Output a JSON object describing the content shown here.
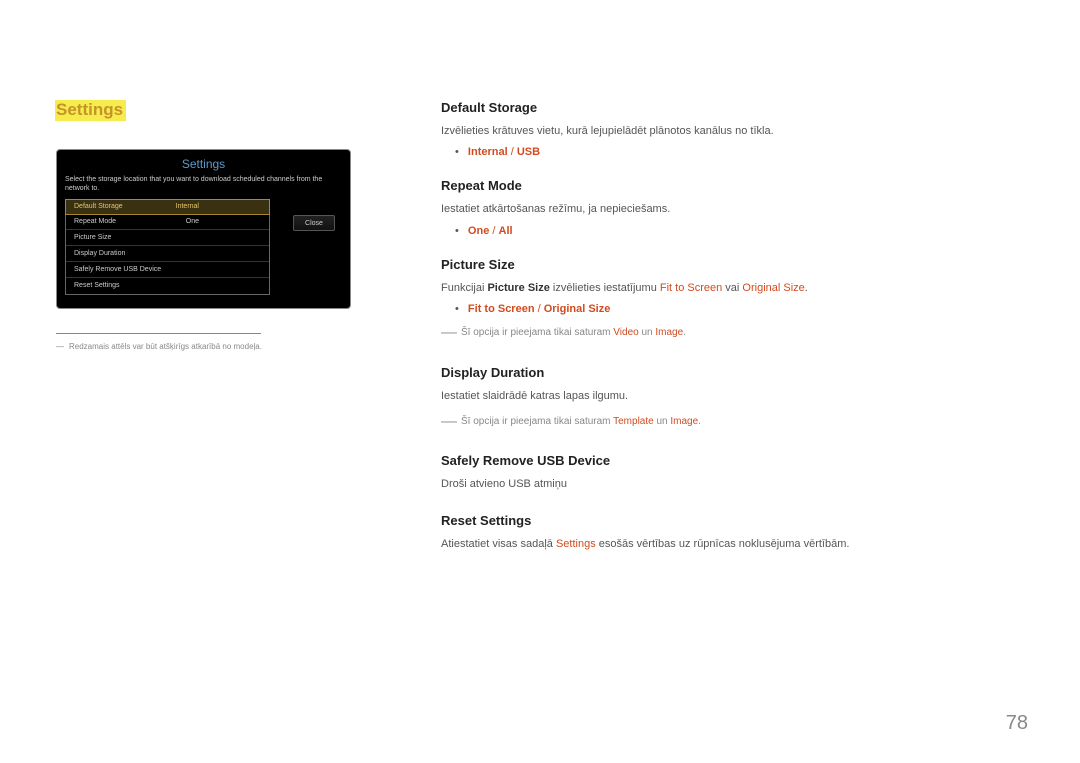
{
  "pageNumber": "78",
  "left": {
    "heading": "Settings",
    "panelTitle": "Settings",
    "panelDesc": "Select the storage location that you want to download scheduled channels from the network to.",
    "rows": [
      {
        "label": "Default Storage",
        "value": "Internal",
        "highlight": true
      },
      {
        "label": "Repeat Mode",
        "value": "One",
        "highlight": false
      },
      {
        "label": "Picture Size",
        "value": "",
        "highlight": false
      },
      {
        "label": "Display Duration",
        "value": "",
        "highlight": false
      },
      {
        "label": "Safely Remove USB Device",
        "value": "",
        "highlight": false
      },
      {
        "label": "Reset Settings",
        "value": "",
        "highlight": false
      }
    ],
    "closeLabel": "Close",
    "footnotePrefix": "―",
    "footnote": "Redzamais attēls var būt atšķirīgs atkarībā no modeļa."
  },
  "right": {
    "defaultStorage": {
      "heading": "Default Storage",
      "desc": "Izvēlieties krātuves vietu, kurā lejupielādēt plānotos kanālus no tīkla.",
      "bulletA": "Internal",
      "bulletB": "USB"
    },
    "repeatMode": {
      "heading": "Repeat Mode",
      "desc": "Iestatiet atkārtošanas režīmu, ja nepieciešams.",
      "bulletA": "One",
      "bulletB": "All"
    },
    "pictureSize": {
      "heading": "Picture Size",
      "descPre": "Funkcijai ",
      "descBold1": "Picture Size",
      "descMid": " izvēlieties iestatījumu ",
      "descAccent1": "Fit to Screen",
      "descVai": " vai ",
      "descAccent2": "Original Size",
      "descEnd": ".",
      "bulletA": "Fit to Screen",
      "bulletB": "Original Size",
      "notePre": "Šī opcija ir pieejama tikai saturam ",
      "noteBold1": "Video",
      "noteUn": " un ",
      "noteBold2": "Image",
      "noteEnd": "."
    },
    "displayDuration": {
      "heading": "Display Duration",
      "desc": "Iestatiet slaidrādē katras lapas ilgumu.",
      "notePre": "Šī opcija ir pieejama tikai saturam ",
      "noteBold1": "Template",
      "noteUn": " un ",
      "noteBold2": "Image",
      "noteEnd": "."
    },
    "safelyRemove": {
      "heading": "Safely Remove USB Device",
      "desc": "Droši atvieno USB atmiņu"
    },
    "resetSettings": {
      "heading": "Reset Settings",
      "descPre": "Atiestatiet visas sadaļā ",
      "descAccent": "Settings",
      "descPost": " esošās vērtības uz rūpnīcas noklusējuma vērtībām."
    }
  }
}
